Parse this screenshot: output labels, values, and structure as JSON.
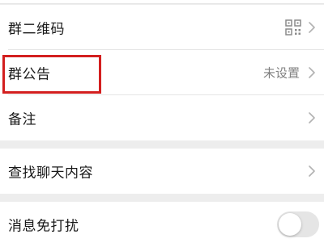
{
  "settings": {
    "group_qr_code": {
      "label": "群二维码",
      "icon": "qr-code-icon"
    },
    "group_notice": {
      "label": "群公告",
      "value": "未设置"
    },
    "remark": {
      "label": "备注"
    },
    "search_chat": {
      "label": "查找聊天内容"
    },
    "mute_notifications": {
      "label": "消息免打扰",
      "enabled": false
    }
  },
  "colors": {
    "highlight": "#d31f1f",
    "background": "#ededed",
    "row_background": "#ffffff"
  }
}
